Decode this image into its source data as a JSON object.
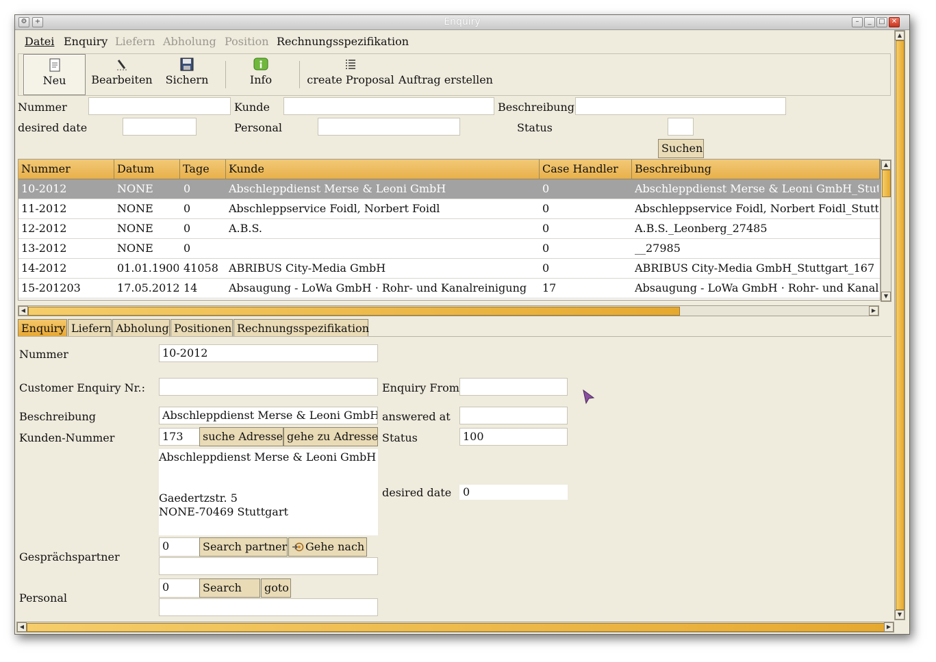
{
  "window": {
    "title": "Enquiry"
  },
  "menu": [
    {
      "label": "Datei",
      "enabled": true
    },
    {
      "label": "Enquiry",
      "enabled": true
    },
    {
      "label": "Liefern",
      "enabled": false
    },
    {
      "label": "Abholung",
      "enabled": false
    },
    {
      "label": "Position",
      "enabled": false
    },
    {
      "label": "Rechnungsspezifikation",
      "enabled": true
    }
  ],
  "toolbar": {
    "neu": {
      "label": "Neu",
      "icon": "new-document-icon"
    },
    "bearbeiten": {
      "label": "Bearbeiten",
      "icon": "pencil-icon"
    },
    "sichern": {
      "label": "Sichern",
      "icon": "floppy-icon"
    },
    "info": {
      "label": "Info",
      "icon": "info-icon"
    },
    "create_proposal": {
      "label": "create Proposal",
      "icon": "list-icon"
    },
    "auftrag": {
      "label": "Auftrag erstellen"
    }
  },
  "search": {
    "nummer_label": "Nummer",
    "kunde_label": "Kunde",
    "beschreibung_label": "Beschreibung",
    "desired_date_label": "desired date",
    "personal_label": "Personal",
    "status_label": "Status",
    "suchen_button": "Suchen",
    "nummer_value": "",
    "kunde_value": "",
    "beschreibung_value": "",
    "desired_date_value": "",
    "personal_value": "",
    "status_value": ""
  },
  "grid": {
    "headers": [
      "Nummer",
      "Datum",
      "Tage",
      "Kunde",
      "Case Handler",
      "Beschreibung"
    ],
    "rows": [
      [
        "10-2012",
        "NONE",
        "0",
        "Abschleppdienst Merse & Leoni GmbH",
        "0",
        "Abschleppdienst Merse & Leoni GmbH_Stuttgart"
      ],
      [
        "11-2012",
        "NONE",
        "0",
        "Abschleppservice Foidl, Norbert Foidl",
        "0",
        "Abschleppservice Foidl, Norbert Foidl_Stuttgart"
      ],
      [
        "12-2012",
        "NONE",
        "0",
        "A.B.S.",
        "0",
        "A.B.S._Leonberg_27485"
      ],
      [
        "13-2012",
        "NONE",
        "0",
        "",
        "0",
        "__27985"
      ],
      [
        "14-2012",
        "01.01.1900",
        "41058",
        "ABRIBUS City-Media GmbH",
        "0",
        "ABRIBUS City-Media GmbH_Stuttgart_167"
      ],
      [
        "15-201203",
        "17.05.2012",
        "14",
        "Absaugung - LoWa GmbH · Rohr- und Kanalreinigung",
        "17",
        "Absaugung - LoWa GmbH · Rohr- und Kanalreinigung"
      ]
    ],
    "selected_row": 0
  },
  "tabs": [
    "Enquiry",
    "Liefern",
    "Abholung",
    "Positionen",
    "Rechnungsspezifikation"
  ],
  "detail": {
    "nummer_label": "Nummer",
    "nummer_value": "10-2012",
    "customer_enquiry_label": "Customer Enquiry Nr.:",
    "customer_enquiry_value": "",
    "enquiry_from_label": "Enquiry From",
    "enquiry_from_value": "",
    "beschreibung_label": "Beschreibung",
    "beschreibung_value": "Abschleppdienst Merse & Leoni GmbH_",
    "answered_at_label": "answered at",
    "answered_at_value": "",
    "kunden_nummer_label": "Kunden-Nummer",
    "kunden_nummer_value": "173",
    "suche_adresse_button": "suche Adresse",
    "gehe_zu_adresse_button": "gehe zu Adresse",
    "status_label": "Status",
    "status_value": "100",
    "address_lines": [
      "Abschleppdienst Merse & Leoni GmbH",
      "",
      "",
      "Gaedertzstr. 5",
      "NONE-70469 Stuttgart"
    ],
    "desired_date_label": "desired date",
    "desired_date_value": "0",
    "gespraechspartner_label": "Gesprächspartner",
    "gespraechspartner_value": "0",
    "gespraechspartner_name": "",
    "search_partner_button": "Search partner",
    "gehe_nach_button": "Gehe nach",
    "personal_label": "Personal",
    "personal_value": "0",
    "personal_name": "",
    "search_button": "Search",
    "goto_button": "goto"
  }
}
